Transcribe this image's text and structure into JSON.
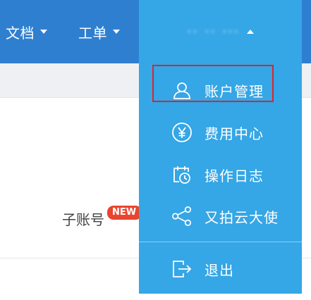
{
  "header": {
    "nav": [
      {
        "label": "文档"
      },
      {
        "label": "工单"
      }
    ],
    "user": {
      "name": "·· ·· ···"
    }
  },
  "content": {
    "sub_account_label": "子账号",
    "new_badge": "NEW"
  },
  "user_menu": {
    "items": [
      {
        "label": "账户管理",
        "icon": "user-icon"
      },
      {
        "label": "费用中心",
        "icon": "yen-icon"
      },
      {
        "label": "操作日志",
        "icon": "clock-calendar-icon"
      },
      {
        "label": "又拍云大使",
        "icon": "share-icon"
      },
      {
        "label": "退出",
        "icon": "logout-icon"
      }
    ]
  },
  "colors": {
    "header_bg": "#2f7fd0",
    "menu_bg": "#35a6e6",
    "highlight": "#d9262c",
    "badge": "#e8452f"
  }
}
